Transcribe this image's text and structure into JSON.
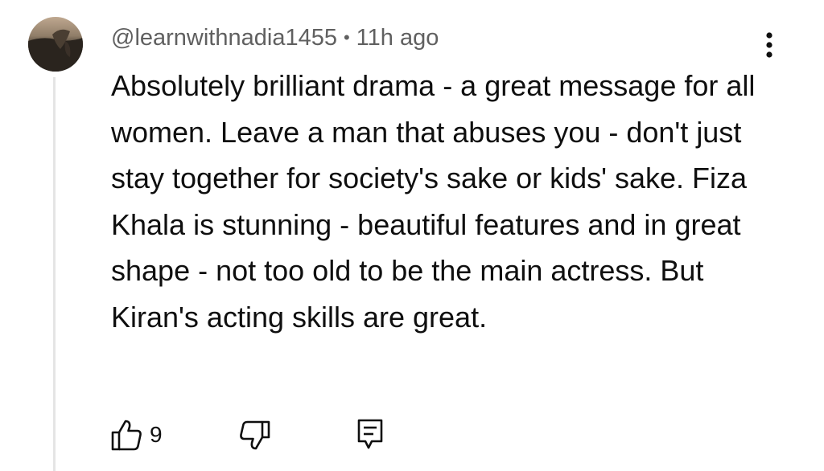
{
  "comment": {
    "author_handle": "@learnwithnadia1455",
    "separator": "•",
    "timestamp": "11h ago",
    "body": "Absolutely brilliant drama - a great message for all women. Leave a man that abuses you - don't just stay together for society's sake or kids' sake. Fiza Khala is stunning - beautiful features and in great shape - not too old to be the main actress. But Kiran's acting skills are great.",
    "like_count": "9",
    "icons": {
      "avatar": "user-avatar",
      "more": "more-vertical-icon",
      "like": "thumbs-up-icon",
      "dislike": "thumbs-down-icon",
      "reply": "reply-comment-icon"
    }
  }
}
